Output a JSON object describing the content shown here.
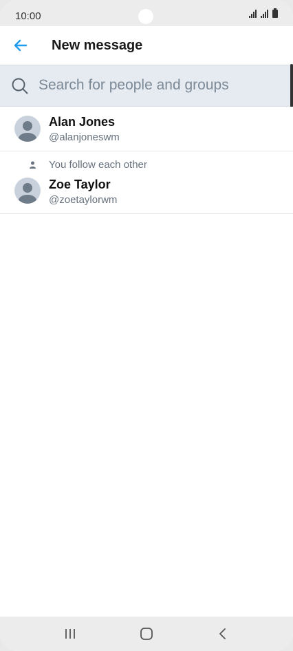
{
  "status_bar": {
    "time": "10:00"
  },
  "header": {
    "title": "New message",
    "back_icon": "arrow-left-icon"
  },
  "search": {
    "placeholder": "Search for people and groups",
    "value": ""
  },
  "contacts": [
    {
      "name": "Alan Jones",
      "handle": "@alanjoneswm",
      "context": ""
    },
    {
      "name": "Zoe Taylor",
      "handle": "@zoetaylorwm",
      "context": "You follow each other"
    }
  ],
  "colors": {
    "accent": "#1d9bf0",
    "search_bg": "#e6ebf1",
    "secondary_text": "#66717d"
  },
  "navbar": {
    "icons": [
      "recent-apps-icon",
      "home-icon",
      "back-icon"
    ]
  }
}
